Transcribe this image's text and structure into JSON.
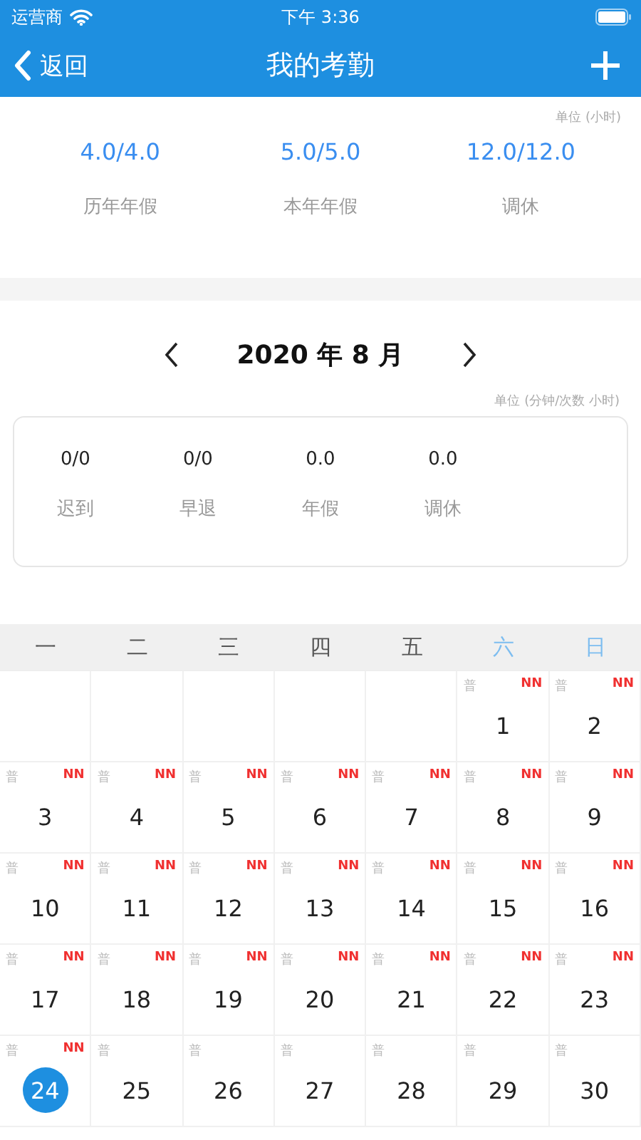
{
  "status_bar": {
    "carrier": "运营商",
    "time": "下午 3:36"
  },
  "nav": {
    "back": "返回",
    "title": "我的考勤"
  },
  "summary": {
    "unit": "单位 (小时)",
    "items": [
      {
        "value": "4.0/4.0",
        "label": "历年年假"
      },
      {
        "value": "5.0/5.0",
        "label": "本年年假"
      },
      {
        "value": "12.0/12.0",
        "label": "调休"
      }
    ]
  },
  "month": {
    "title": "2020 年 8 月",
    "unit": "单位 (分钟/次数  小时)",
    "stats": [
      {
        "value": "0/0",
        "label": "迟到"
      },
      {
        "value": "0/0",
        "label": "早退"
      },
      {
        "value": "0.0",
        "label": "年假"
      },
      {
        "value": "0.0",
        "label": "调休"
      }
    ]
  },
  "weekdays": [
    {
      "label": "一",
      "weekend": false
    },
    {
      "label": "二",
      "weekend": false
    },
    {
      "label": "三",
      "weekend": false
    },
    {
      "label": "四",
      "weekend": false
    },
    {
      "label": "五",
      "weekend": false
    },
    {
      "label": "六",
      "weekend": true
    },
    {
      "label": "日",
      "weekend": true
    }
  ],
  "cells": [
    {
      "kind": "blank"
    },
    {
      "kind": "blank"
    },
    {
      "kind": "blank"
    },
    {
      "kind": "blank"
    },
    {
      "kind": "blank"
    },
    {
      "kind": "day",
      "tag": "普",
      "flag": "NN",
      "day": "1",
      "selected": false
    },
    {
      "kind": "day",
      "tag": "普",
      "flag": "NN",
      "day": "2",
      "selected": false
    },
    {
      "kind": "day",
      "tag": "普",
      "flag": "NN",
      "day": "3",
      "selected": false
    },
    {
      "kind": "day",
      "tag": "普",
      "flag": "NN",
      "day": "4",
      "selected": false
    },
    {
      "kind": "day",
      "tag": "普",
      "flag": "NN",
      "day": "5",
      "selected": false
    },
    {
      "kind": "day",
      "tag": "普",
      "flag": "NN",
      "day": "6",
      "selected": false
    },
    {
      "kind": "day",
      "tag": "普",
      "flag": "NN",
      "day": "7",
      "selected": false
    },
    {
      "kind": "day",
      "tag": "普",
      "flag": "NN",
      "day": "8",
      "selected": false
    },
    {
      "kind": "day",
      "tag": "普",
      "flag": "NN",
      "day": "9",
      "selected": false
    },
    {
      "kind": "day",
      "tag": "普",
      "flag": "NN",
      "day": "10",
      "selected": false
    },
    {
      "kind": "day",
      "tag": "普",
      "flag": "NN",
      "day": "11",
      "selected": false
    },
    {
      "kind": "day",
      "tag": "普",
      "flag": "NN",
      "day": "12",
      "selected": false
    },
    {
      "kind": "day",
      "tag": "普",
      "flag": "NN",
      "day": "13",
      "selected": false
    },
    {
      "kind": "day",
      "tag": "普",
      "flag": "NN",
      "day": "14",
      "selected": false
    },
    {
      "kind": "day",
      "tag": "普",
      "flag": "NN",
      "day": "15",
      "selected": false
    },
    {
      "kind": "day",
      "tag": "普",
      "flag": "NN",
      "day": "16",
      "selected": false
    },
    {
      "kind": "day",
      "tag": "普",
      "flag": "NN",
      "day": "17",
      "selected": false
    },
    {
      "kind": "day",
      "tag": "普",
      "flag": "NN",
      "day": "18",
      "selected": false
    },
    {
      "kind": "day",
      "tag": "普",
      "flag": "NN",
      "day": "19",
      "selected": false
    },
    {
      "kind": "day",
      "tag": "普",
      "flag": "NN",
      "day": "20",
      "selected": false
    },
    {
      "kind": "day",
      "tag": "普",
      "flag": "NN",
      "day": "21",
      "selected": false
    },
    {
      "kind": "day",
      "tag": "普",
      "flag": "NN",
      "day": "22",
      "selected": false
    },
    {
      "kind": "day",
      "tag": "普",
      "flag": "NN",
      "day": "23",
      "selected": false
    },
    {
      "kind": "day",
      "tag": "普",
      "flag": "NN",
      "day": "24",
      "selected": true
    },
    {
      "kind": "day",
      "tag": "普",
      "day": "25",
      "selected": false
    },
    {
      "kind": "day",
      "tag": "普",
      "day": "26",
      "selected": false
    },
    {
      "kind": "day",
      "tag": "普",
      "day": "27",
      "selected": false
    },
    {
      "kind": "day",
      "tag": "普",
      "day": "28",
      "selected": false
    },
    {
      "kind": "day",
      "tag": "普",
      "day": "29",
      "selected": false
    },
    {
      "kind": "day",
      "tag": "普",
      "day": "30",
      "selected": false
    }
  ]
}
